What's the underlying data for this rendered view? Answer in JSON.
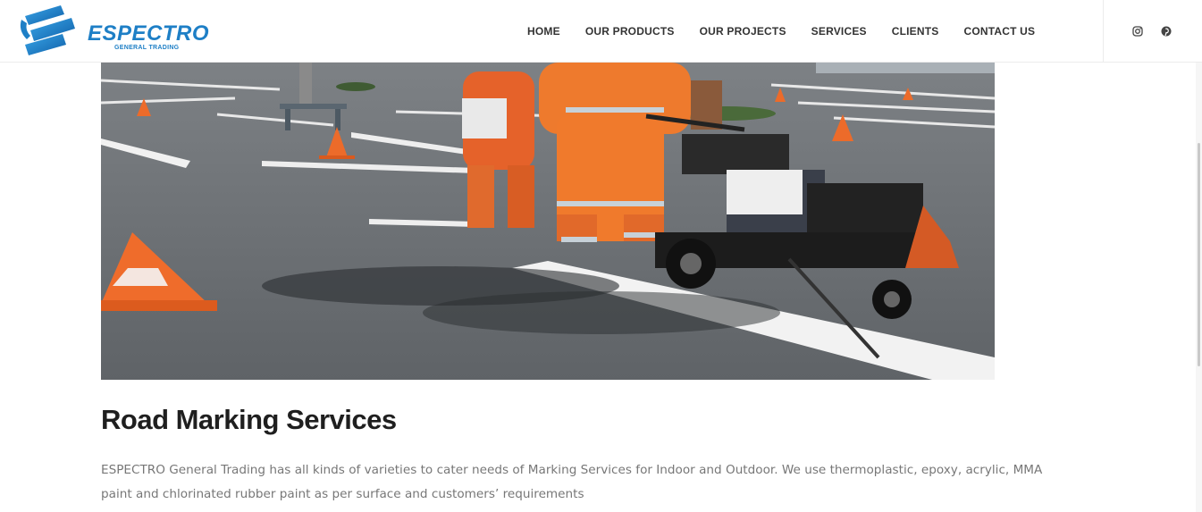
{
  "header": {
    "logo_text": "ESPECTRO",
    "logo_subtext": "GENERAL TRADING",
    "nav": [
      {
        "label": "HOME"
      },
      {
        "label": "OUR PRODUCTS"
      },
      {
        "label": "OUR PROJECTS"
      },
      {
        "label": "SERVICES"
      },
      {
        "label": "CLIENTS"
      },
      {
        "label": "CONTACT US"
      }
    ],
    "social": [
      "instagram-icon",
      "pinterest-icon"
    ]
  },
  "hero": {
    "image_subject": "road-marking-worker-photo"
  },
  "main": {
    "title": "Road Marking Services",
    "description": "ESPECTRO General Trading has all kinds of varieties to cater needs of Marking Services for Indoor and Outdoor. We use thermoplastic, epoxy, acrylic, MMA paint and chlorinated rubber paint as per surface and customers’ requirements"
  },
  "colors": {
    "brand": "#1e7fc6",
    "text_dark": "#1f1f1f",
    "text_muted": "#777777"
  }
}
